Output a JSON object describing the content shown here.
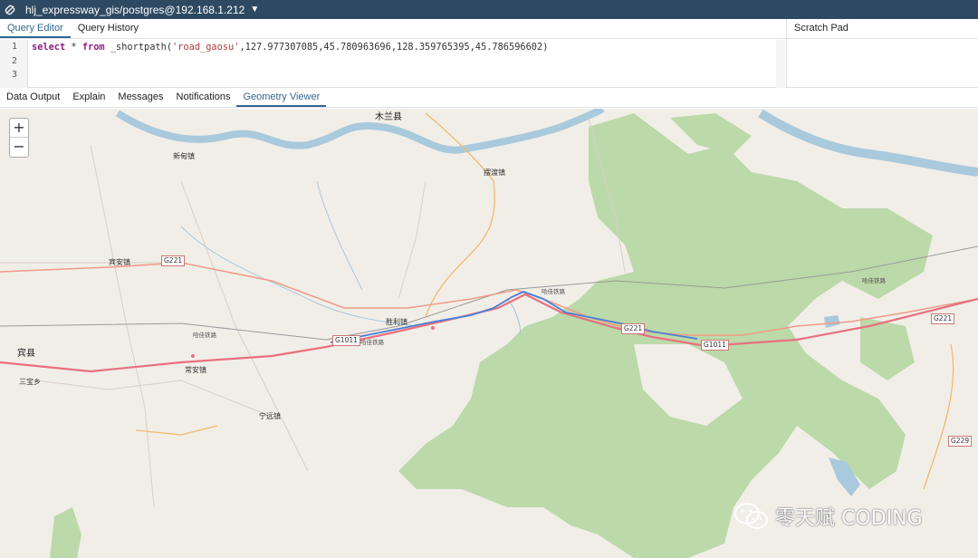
{
  "connection": {
    "title": "hlj_expressway_gis/postgres@192.168.1.212"
  },
  "query_tabs": [
    "Query Editor",
    "Query History"
  ],
  "scratch_pad": {
    "title": "Scratch Pad"
  },
  "editor": {
    "line_numbers": [
      "1",
      "2",
      "3"
    ],
    "kw1": "select",
    "star": " * ",
    "kw2": "from",
    "fn": " _shortpath(",
    "str": "'road_gaosu'",
    "args": ",127.977307085,45.780963696,128.359765395,45.786596602)"
  },
  "output_tabs": [
    "Data Output",
    "Explain",
    "Messages",
    "Notifications",
    "Geometry Viewer"
  ],
  "zoom": {
    "in": "+",
    "out": "−"
  },
  "map": {
    "places": {
      "mulan": "木兰县",
      "xindian": "新甸镇",
      "baidu": "摆渡镇",
      "binan": "宾安镇",
      "shengli": "胜利镇",
      "binxian": "宾县",
      "sanbao": "三宝乡",
      "changan": "常安镇",
      "ningyuan": "宁远镇"
    },
    "shields": {
      "g221_left": "G221",
      "g1011_left": "G1011",
      "g221_mid": "G221",
      "g1011_mid": "G1011",
      "g221_right": "G221",
      "g229": "G229"
    },
    "railway_labels": {
      "r1": "哈佳铁路",
      "r2": "哈佳铁路",
      "r3": "哈佳铁路",
      "r4": "哈佳铁路"
    }
  },
  "watermark": {
    "text": "零天赋 CODING"
  },
  "colors": {
    "header": "#2e4a62",
    "accent": "#326690",
    "forest": "#bcd9a9",
    "river": "#a9c9dc",
    "highway": "#e8707f",
    "route": "#4a7fd6"
  }
}
